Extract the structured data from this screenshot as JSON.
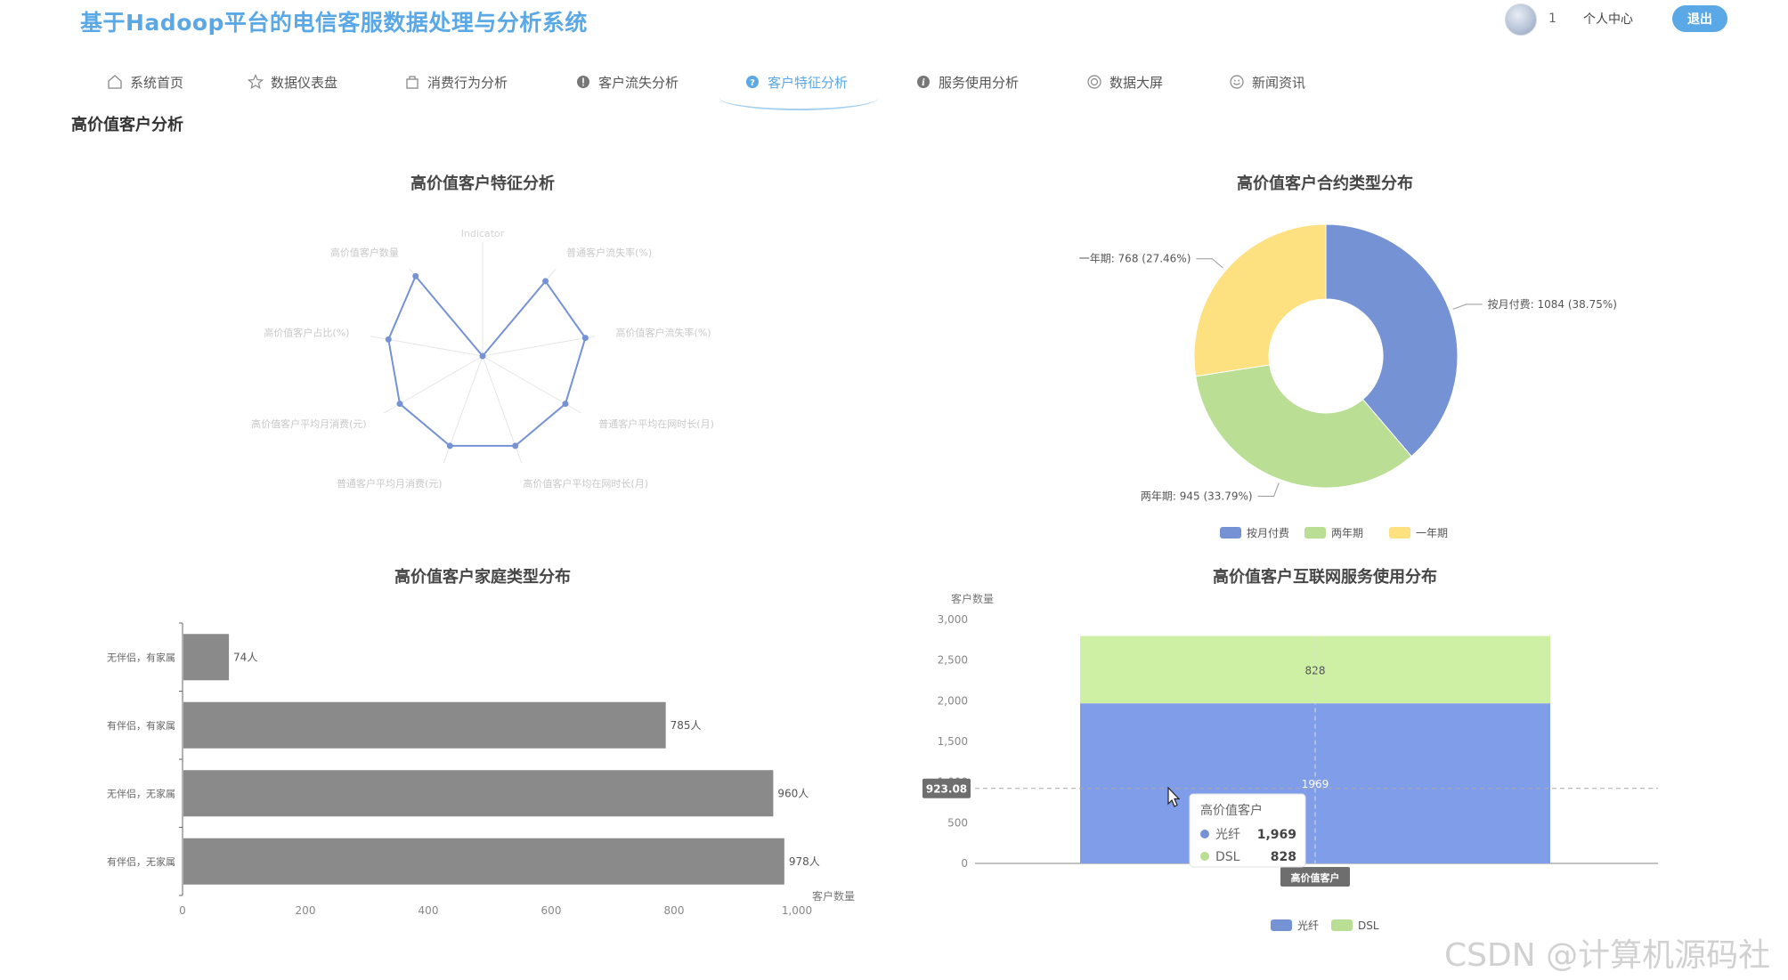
{
  "header": {
    "app_title": "基于Hadoop平台的电信客服数据处理与分析系统",
    "user_count": "1",
    "profile_label": "个人中心",
    "logout_label": "退出"
  },
  "nav": {
    "items": [
      {
        "label": "系统首页",
        "icon": "home-icon"
      },
      {
        "label": "数据仪表盘",
        "icon": "star-icon"
      },
      {
        "label": "消费行为分析",
        "icon": "bag-icon"
      },
      {
        "label": "客户流失分析",
        "icon": "alert-icon"
      },
      {
        "label": "客户特征分析",
        "icon": "question-icon",
        "active": true
      },
      {
        "label": "服务使用分析",
        "icon": "info-icon"
      },
      {
        "label": "数据大屏",
        "icon": "screen-icon"
      },
      {
        "label": "新闻资讯",
        "icon": "news-icon"
      }
    ]
  },
  "page": {
    "section_title": "高价值客户分析"
  },
  "colors": {
    "accent": "#5aa9e6",
    "series_blue": "#7592d4",
    "series_green": "#bade93",
    "series_yellow": "#fde07f",
    "bar_gray": "#8a8a8a",
    "stack_blue": "#7f9de9",
    "stack_green": "#cdf0a4"
  },
  "chart_data": [
    {
      "type": "radar",
      "title": "高价值客户特征分析",
      "center_label": "Indicator",
      "indicators": [
        "普通客户流失率(%)",
        "高价值客户流失率(%)",
        "普通客户平均在网时长(月)",
        "高价值客户平均在网时长(月)",
        "普通客户平均月消费(元)",
        "高价值客户平均月消费(元)",
        "高价值客户占比(%)",
        "高价值客户数量",
        "Indicator"
      ],
      "values": [
        0.9,
        0.96,
        0.88,
        0.88,
        0.88,
        0.88,
        0.88,
        0.96,
        0.0
      ]
    },
    {
      "type": "pie",
      "title": "高价值客户合约类型分布",
      "slices": [
        {
          "name": "按月付费",
          "value": 1084,
          "label": "按月付费: 1084 (38.75%)"
        },
        {
          "name": "两年期",
          "value": 945,
          "label": "两年期: 945 (33.79%)"
        },
        {
          "name": "一年期",
          "value": 768,
          "label": "一年期: 768 (27.46%)"
        }
      ],
      "legend": [
        "按月付费",
        "两年期",
        "一年期"
      ]
    },
    {
      "type": "bar",
      "title": "高价值客户家庭类型分布",
      "orientation": "horizontal",
      "categories": [
        "无伴侣，有家属",
        "有伴侣，有家属",
        "无伴侣，无家属",
        "有伴侣，无家属"
      ],
      "values": [
        74,
        785,
        960,
        978
      ],
      "value_labels": [
        "74人",
        "785人",
        "960人",
        "978人"
      ],
      "xlabel": "客户数量",
      "xlim": [
        0,
        1000
      ],
      "xticks": [
        "0",
        "200",
        "400",
        "600",
        "800",
        "1,000"
      ]
    },
    {
      "type": "bar",
      "title": "高价值客户互联网服务使用分布",
      "stacked": true,
      "categories": [
        "高价值客户"
      ],
      "series": [
        {
          "name": "光纤",
          "values": [
            1969
          ]
        },
        {
          "name": "DSL",
          "values": [
            828
          ]
        }
      ],
      "ylabel": "客户数量",
      "ylim": [
        0,
        3000
      ],
      "yticks": [
        "0",
        "500",
        "1,000",
        "1,500",
        "2,000",
        "2,500",
        "3,000"
      ],
      "legend": [
        "光纤",
        "DSL"
      ],
      "pointer_value": "923.08",
      "tooltip": {
        "title": "高价值客户",
        "rows": [
          {
            "name": "光纤",
            "value": "1,969"
          },
          {
            "name": "DSL",
            "value": "828"
          }
        ]
      }
    }
  ],
  "watermark": "CSDN @计算机源码社"
}
